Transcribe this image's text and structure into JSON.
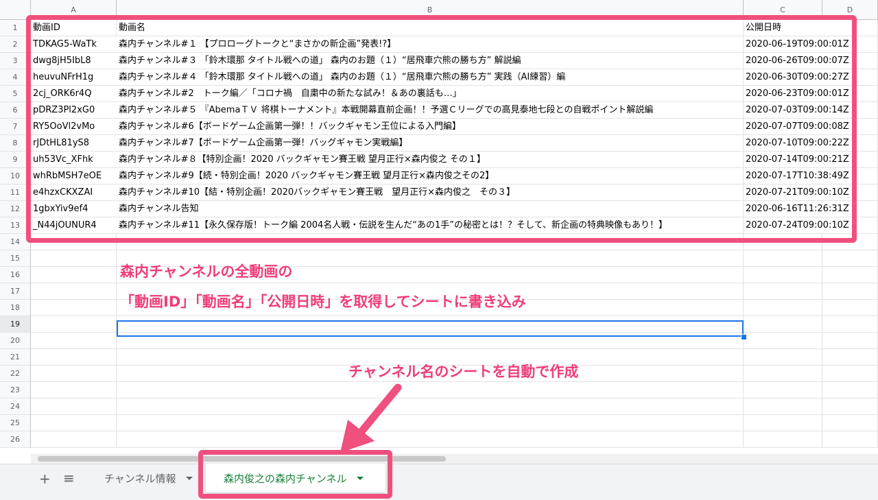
{
  "columns": [
    "A",
    "B",
    "C",
    "D"
  ],
  "headers": {
    "id": "動画ID",
    "name": "動画名",
    "date": "公開日時"
  },
  "rows": [
    {
      "n": "2",
      "id": "TDKAG5-WaTk",
      "name": "森内チャンネル#１ 【プロローグトークと“まさかの新企画”発表!?】",
      "date": "2020-06-19T09:00:01Z"
    },
    {
      "n": "3",
      "id": "dwg8jH5IbL8",
      "name": "森内チャンネル#３ 「鈴木環那 タイトル戦への道」 森内のお題（１）“居飛車穴熊の勝ち方” 解説編",
      "date": "2020-06-26T09:00:07Z"
    },
    {
      "n": "4",
      "id": "heuvuNFrH1g",
      "name": "森内チャンネル#４ 「鈴木環那 タイトル戦への道」 森内のお題（１）“居飛車穴熊の勝ち方” 実践（AI練習）編",
      "date": "2020-06-30T09:00:27Z"
    },
    {
      "n": "5",
      "id": "2cj_ORK6r4Q",
      "name": "森内チャンネル#2　トーク編／「コロナ禍　自粛中の新たな試み！＆あの裏話も…」",
      "date": "2020-06-23T09:00:01Z"
    },
    {
      "n": "6",
      "id": "pDRZ3Pl2xG0",
      "name": "森内チャンネル#５ 『AbemaＴＶ 将棋トーナメント』本戦開幕直前企画！！予選Ｃリーグでの高見泰地七段との自戦ポイント解説編",
      "date": "2020-07-03T09:00:14Z"
    },
    {
      "n": "7",
      "id": "RY5OoVl2vMo",
      "name": "森内チャンネル#6【ボードゲーム企画第一弾！！バックギャモン王位による入門編】",
      "date": "2020-07-07T09:00:08Z"
    },
    {
      "n": "8",
      "id": "rJDtHL81yS8",
      "name": "森内チャンネル#7【ボードゲーム企画第一弾！バッグギャモン実戦編】",
      "date": "2020-07-10T09:00:22Z"
    },
    {
      "n": "9",
      "id": "uh53Vc_XFhk",
      "name": "森内チャンネル#８【特別企画！2020 バックギャモン賽王戦 望月正行×森内俊之 その１】",
      "date": "2020-07-14T09:00:21Z"
    },
    {
      "n": "10",
      "id": "whRbMSH7eOE",
      "name": "森内チャンネル#9【続・特別企画！2020 バックギャモン賽王戦 望月正行×森内俊之その2】",
      "date": "2020-07-17T10:38:49Z"
    },
    {
      "n": "11",
      "id": "e4hzxCKXZAI",
      "name": "森内チャンネル#10【結・特別企画！2020バックギャモン賽王戦　望月正行×森内俊之　その３】",
      "date": "2020-07-21T09:00:10Z"
    },
    {
      "n": "12",
      "id": "1gbxYiv9ef4",
      "name": "森内チャンネル告知",
      "date": "2020-06-16T11:26:31Z"
    },
    {
      "n": "13",
      "id": "_N44jOUNUR4",
      "name": "森内チャンネル#11【永久保存版！トーク編 2004名人戦・伝説を生んだ“あの1手”の秘密とは！？そして、新企画の特典映像もあり！】",
      "date": "2020-07-24T09:00:10Z"
    }
  ],
  "empty_rows": [
    "14",
    "15",
    "16",
    "17",
    "18",
    "19",
    "20",
    "21",
    "22",
    "23",
    "24",
    "25",
    "26"
  ],
  "header_row_number": "1",
  "selected_row": "19",
  "annotations": {
    "line1": "森内チャンネルの全動画の",
    "line2": "「動画ID」「動画名」「公開日時」を取得してシートに書き込み",
    "line3": "チャンネル名のシートを自動で作成"
  },
  "tabs": {
    "add": "+",
    "list": "≡",
    "sheet1": "チャンネル情報",
    "sheet2": "森内俊之の森内チャンネル"
  },
  "colors": {
    "annotation": "#ef3d7a",
    "selection": "#1a73e8",
    "active_tab": "#188038"
  }
}
